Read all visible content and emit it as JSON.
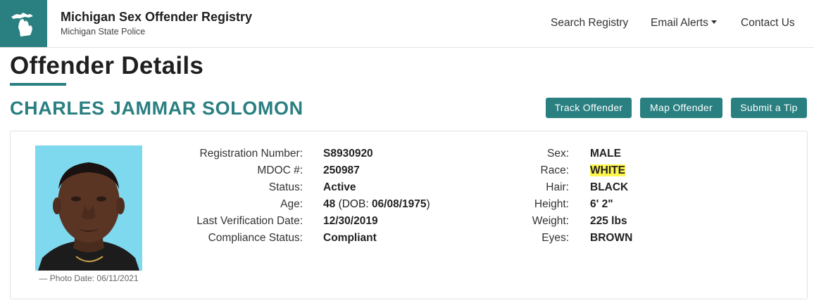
{
  "header": {
    "brand_title": "Michigan Sex Offender Registry",
    "brand_subtitle": "Michigan State Police",
    "logo_icon": "michigan-map-icon",
    "nav": {
      "search": "Search Registry",
      "email_alerts": "Email Alerts",
      "contact": "Contact Us"
    }
  },
  "page": {
    "title": "Offender Details",
    "offender_name": "CHARLES JAMMAR SOLOMON"
  },
  "actions": {
    "track": "Track Offender",
    "map": "Map Offender",
    "tip": "Submit a Tip"
  },
  "photo": {
    "caption": "— Photo Date: 06/11/2021"
  },
  "details_left": {
    "registration_number": {
      "label": "Registration Number:",
      "value": "S8930920"
    },
    "mdoc": {
      "label": "MDOC #:",
      "value": "250987"
    },
    "status": {
      "label": "Status:",
      "value": "Active"
    },
    "age": {
      "label": "Age:",
      "value": "48",
      "dob_prefix": "(DOB: ",
      "dob": "06/08/1975",
      "dob_suffix": ")"
    },
    "last_verification": {
      "label": "Last Verification Date:",
      "value": "12/30/2019"
    },
    "compliance": {
      "label": "Compliance Status:",
      "value": "Compliant"
    }
  },
  "details_right": {
    "sex": {
      "label": "Sex:",
      "value": "MALE"
    },
    "race": {
      "label": "Race:",
      "value": "WHITE"
    },
    "hair": {
      "label": "Hair:",
      "value": "BLACK"
    },
    "height": {
      "label": "Height:",
      "value": "6' 2\""
    },
    "weight": {
      "label": "Weight:",
      "value": "225 lbs"
    },
    "eyes": {
      "label": "Eyes:",
      "value": "BROWN"
    }
  },
  "colors": {
    "brand": "#2a7f81",
    "highlight": "#fdf44d",
    "photo_background": "#7ed8ee"
  }
}
